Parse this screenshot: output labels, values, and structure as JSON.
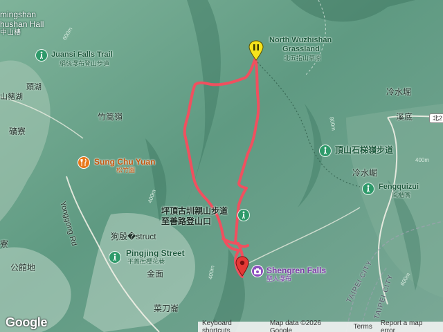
{
  "map": {
    "places": {
      "top_left_en_1": "mingshan",
      "top_left_en_2": "hushan Hall",
      "top_left_zh": "中山樓",
      "juansi_en": "Juansi Falls Trail",
      "juansi_zh": "絹絲瀑布登山步道",
      "north_wuzhishan_en_1": "North Wuzhishan",
      "north_wuzhishan_en_2": "Grassland",
      "north_wuzhishan_zh": "北五指山草原",
      "touhu": "頭湖",
      "shanzhuhu": "山豬湖",
      "zhugaoling": "竹篙嶺",
      "kuangliao": "礦寮",
      "lengshuikeng": "冷水堀",
      "xidi": "溪底",
      "dingshan_trail": "頂山石梯嶺步道",
      "lengshuijue": "冷水崛",
      "fengqui_en": "Fengquizui",
      "fengqui_zh": "風櫃嘴",
      "sungchu_en": "Sung Chu Yuan",
      "sungchu_zh": "松竹園",
      "yonggong": "Yonggong Rd",
      "pingding_trail_1": "坪頂古圳親山步道",
      "pingding_trail_2": "至善路登山口",
      "goubandong": "狗殷�struct",
      "pingjing_en": "Pingjing Street",
      "pingjing_zh": "平菁街櫻花巷",
      "jinmian": "金面",
      "liao": "寮",
      "gongguandi": "公館地",
      "caidaolun": "菜刀崙",
      "shengren_en": "Shengren Falls",
      "shengren_zh": "聖人瀑布",
      "taipei_city_1": "TAIPEI CITY",
      "taipei_city_2": "TAIPEI CITY",
      "highway_shield": "北2"
    },
    "contour_labels": [
      "600m",
      "800m",
      "400m",
      "400m",
      "600m",
      "400m"
    ],
    "icons": {
      "juansi": "hiking-icon",
      "dingshan": "hiking-icon",
      "fengqui": "hiking-icon",
      "pingjing": "hiking-icon",
      "pingding": "hiking-icon",
      "sungchu": "restaurant-icon",
      "shengren": "camera-icon",
      "start_marker": "trail-start-marker-icon",
      "end_marker": "trail-end-marker-icon"
    },
    "colors": {
      "route": "#f0505f",
      "terrain": "#6fa58f",
      "hiking_pin": "#2e9a6a",
      "restaurant_pin": "#e8791c",
      "attraction_pin": "#8e51bf",
      "start_marker": "#f5e31c",
      "end_marker": "#e53935"
    }
  },
  "footer": {
    "google": "Google",
    "keyboard": "Keyboard shortcuts",
    "mapdata": "Map data ©2026 Google",
    "terms": "Terms",
    "report": "Report a map error"
  }
}
